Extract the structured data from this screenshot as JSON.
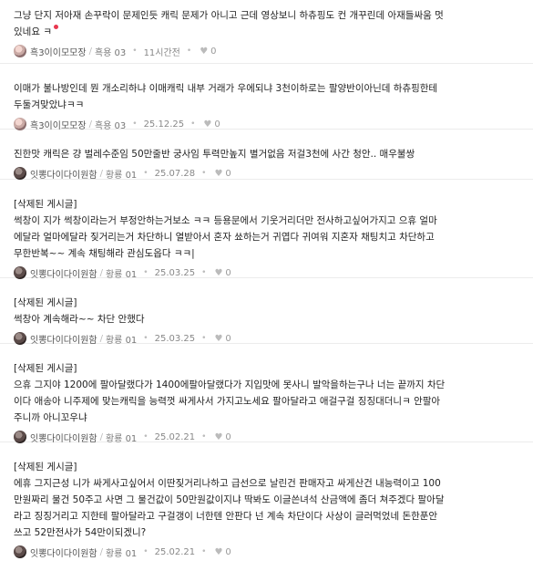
{
  "comments": [
    {
      "lines": [
        "그냥 단지 저아재 손꾸락이 문제인듯 캐릭 문제가 아니고 근데 영상보니 하츄핑도 컨 개꾸린데 아재들싸움 멋",
        "있네요 ㅋ"
      ],
      "new": true,
      "nick": "흑3이이모모장",
      "level": "흑용 03",
      "date": "11시간전",
      "likes": "0",
      "avatar": "pink"
    },
    {
      "lines": [
        "이매가 불나방인데 뭔 개소리하냐 이매캐릭 내부 거래가 우에되냐 3천이하로는 팔양반이아닌데 하츄핑한테",
        "두둘겨맞았냐ㅋㅋ"
      ],
      "new": false,
      "nick": "흑3이이모모장",
      "level": "흑용 03",
      "date": "25.12.25",
      "likes": "0",
      "avatar": "pink"
    },
    {
      "lines": [
        "진한맛 캐릭은 걍 벌레수준임 50만줄반 궁사임 투력만높지 별거없음 저걸3천에 사간 청안.. 매우불쌍"
      ],
      "new": false,
      "nick": "잇뽕다이다이원함",
      "level": "황룡 01",
      "date": "25.07.28",
      "likes": "0",
      "avatar": "dark"
    },
    {
      "lines": [
        "[삭제된 게시글]",
        "썩창이 지가 썩창이라는거 부정안하는거보소 ㅋㅋ 등용문에서 기웃거리더만 전사하고싶어가지고 으휴 얼마",
        "에달라 얼마에달라 짖거리는거 차단하니 열받아서 혼자 쑈하는거 귀엽다 귀여워 지혼자 채팅치고 차단하고",
        "무한반복~~ 계속 채팅해라 관심도옵다 ㅋㅋ|"
      ],
      "new": false,
      "nick": "잇뽕다이다이원함",
      "level": "황룡 01",
      "date": "25.03.25",
      "likes": "0",
      "avatar": "dark"
    },
    {
      "lines": [
        "[삭제된 게시글]",
        "썩창아 계속해라~~ 차단 안했다"
      ],
      "new": false,
      "nick": "잇뽕다이다이원함",
      "level": "황룡 01",
      "date": "25.03.25",
      "likes": "0",
      "avatar": "dark"
    },
    {
      "lines": [
        "[삭제된 게시글]",
        "으휴 그지야 1200에 팔아달랬다가 1400에팔아달랬다가 지입맛에 못사니 발악을하는구나 너는 끝까지 차단",
        "이다 애송아 니주제에 맞는캐릭을 능력껏 싸게사서 가지고노세요 팔아달라고 애걸구걸 징징대더니ㅋ 안팔아",
        "주니까 아니꼬우냐"
      ],
      "new": false,
      "nick": "잇뽕다이다이원함",
      "level": "황룡 01",
      "date": "25.02.21",
      "likes": "0",
      "avatar": "dark"
    },
    {
      "lines": [
        "[삭제된 게시글]",
        "에휴 그지근성 니가 싸게사고싶어서 이딴짖거리나하고 급선으로 날린건 판매자고 싸게산건 내능력이고 100",
        "만원짜리 물건 50주고 사면 그 물건값이 50만원값이지냐 딱봐도 이글쓴녀석 산금액에 좀더 쳐주겠다 팔아달",
        "라고 징징거리고 지한테 팔아달라고 구걸갱이 너한텐 안판다 넌 계속 차단이다 사상이 글러먹었네 돈한푼안",
        "쓰고 52만전사가 54만이되겠니?"
      ],
      "new": false,
      "nick": "잇뽕다이다이원함",
      "level": "황룡 01",
      "date": "25.02.21",
      "likes": "0",
      "avatar": "dark"
    }
  ]
}
